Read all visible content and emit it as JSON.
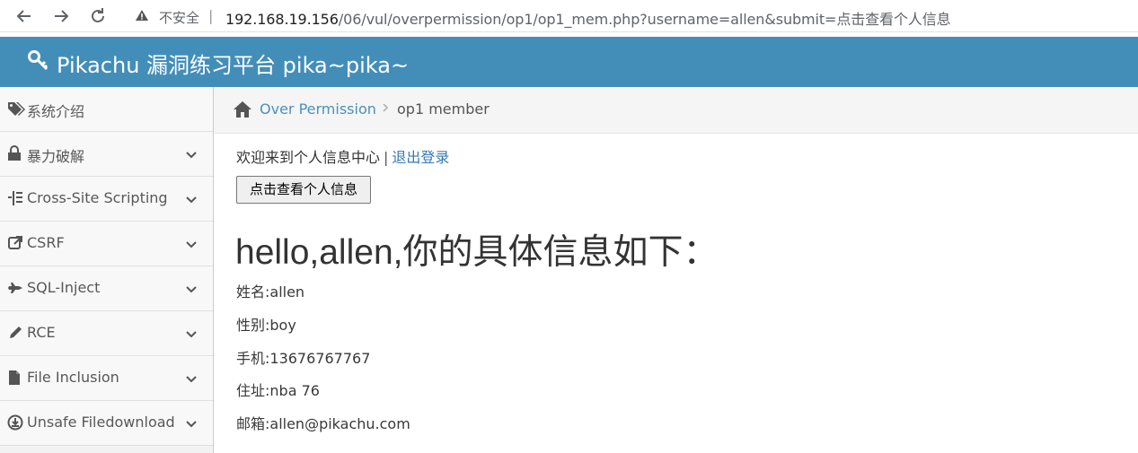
{
  "browser": {
    "back_icon": "arrow-left-icon",
    "forward_icon": "arrow-right-icon",
    "reload_icon": "reload-icon",
    "security_label": "不安全",
    "separator": "|",
    "url_host": "192.168.19.156",
    "url_path": "/06/vul/overpermission/op1/op1_mem.php?username=allen&submit=点击查看个人信息"
  },
  "header": {
    "title": "Pikachu 漏洞练习平台 pika~pika~",
    "accent_color": "#438eb9",
    "icon": "key-icon"
  },
  "sidebar": {
    "items": [
      {
        "label": "系统介绍",
        "icon": "tags-icon",
        "expandable": false
      },
      {
        "label": "暴力破解",
        "icon": "lock-icon",
        "expandable": true
      },
      {
        "label": "Cross-Site Scripting",
        "icon": "indent-icon",
        "expandable": true
      },
      {
        "label": "CSRF",
        "icon": "share-icon",
        "expandable": true
      },
      {
        "label": "SQL-Inject",
        "icon": "fighter-jet-icon",
        "expandable": true
      },
      {
        "label": "RCE",
        "icon": "pencil-icon",
        "expandable": true
      },
      {
        "label": "File Inclusion",
        "icon": "file-icon",
        "expandable": true
      },
      {
        "label": "Unsafe Filedownload",
        "icon": "download-icon",
        "expandable": true
      }
    ]
  },
  "breadcrumb": {
    "home_icon": "home-icon",
    "link": "Over Permission",
    "separator": ">",
    "current": "op1 member"
  },
  "main": {
    "welcome_text": "欢迎来到个人信息中心",
    "pipe": "|",
    "logout_label": "退出登录",
    "view_button_label": "点击查看个人信息",
    "greeting": "hello,allen,你的具体信息如下：",
    "info": [
      "姓名:allen",
      "性别:boy",
      "手机:13676767767",
      "住址:nba 76",
      "邮箱:allen@pikachu.com"
    ]
  }
}
